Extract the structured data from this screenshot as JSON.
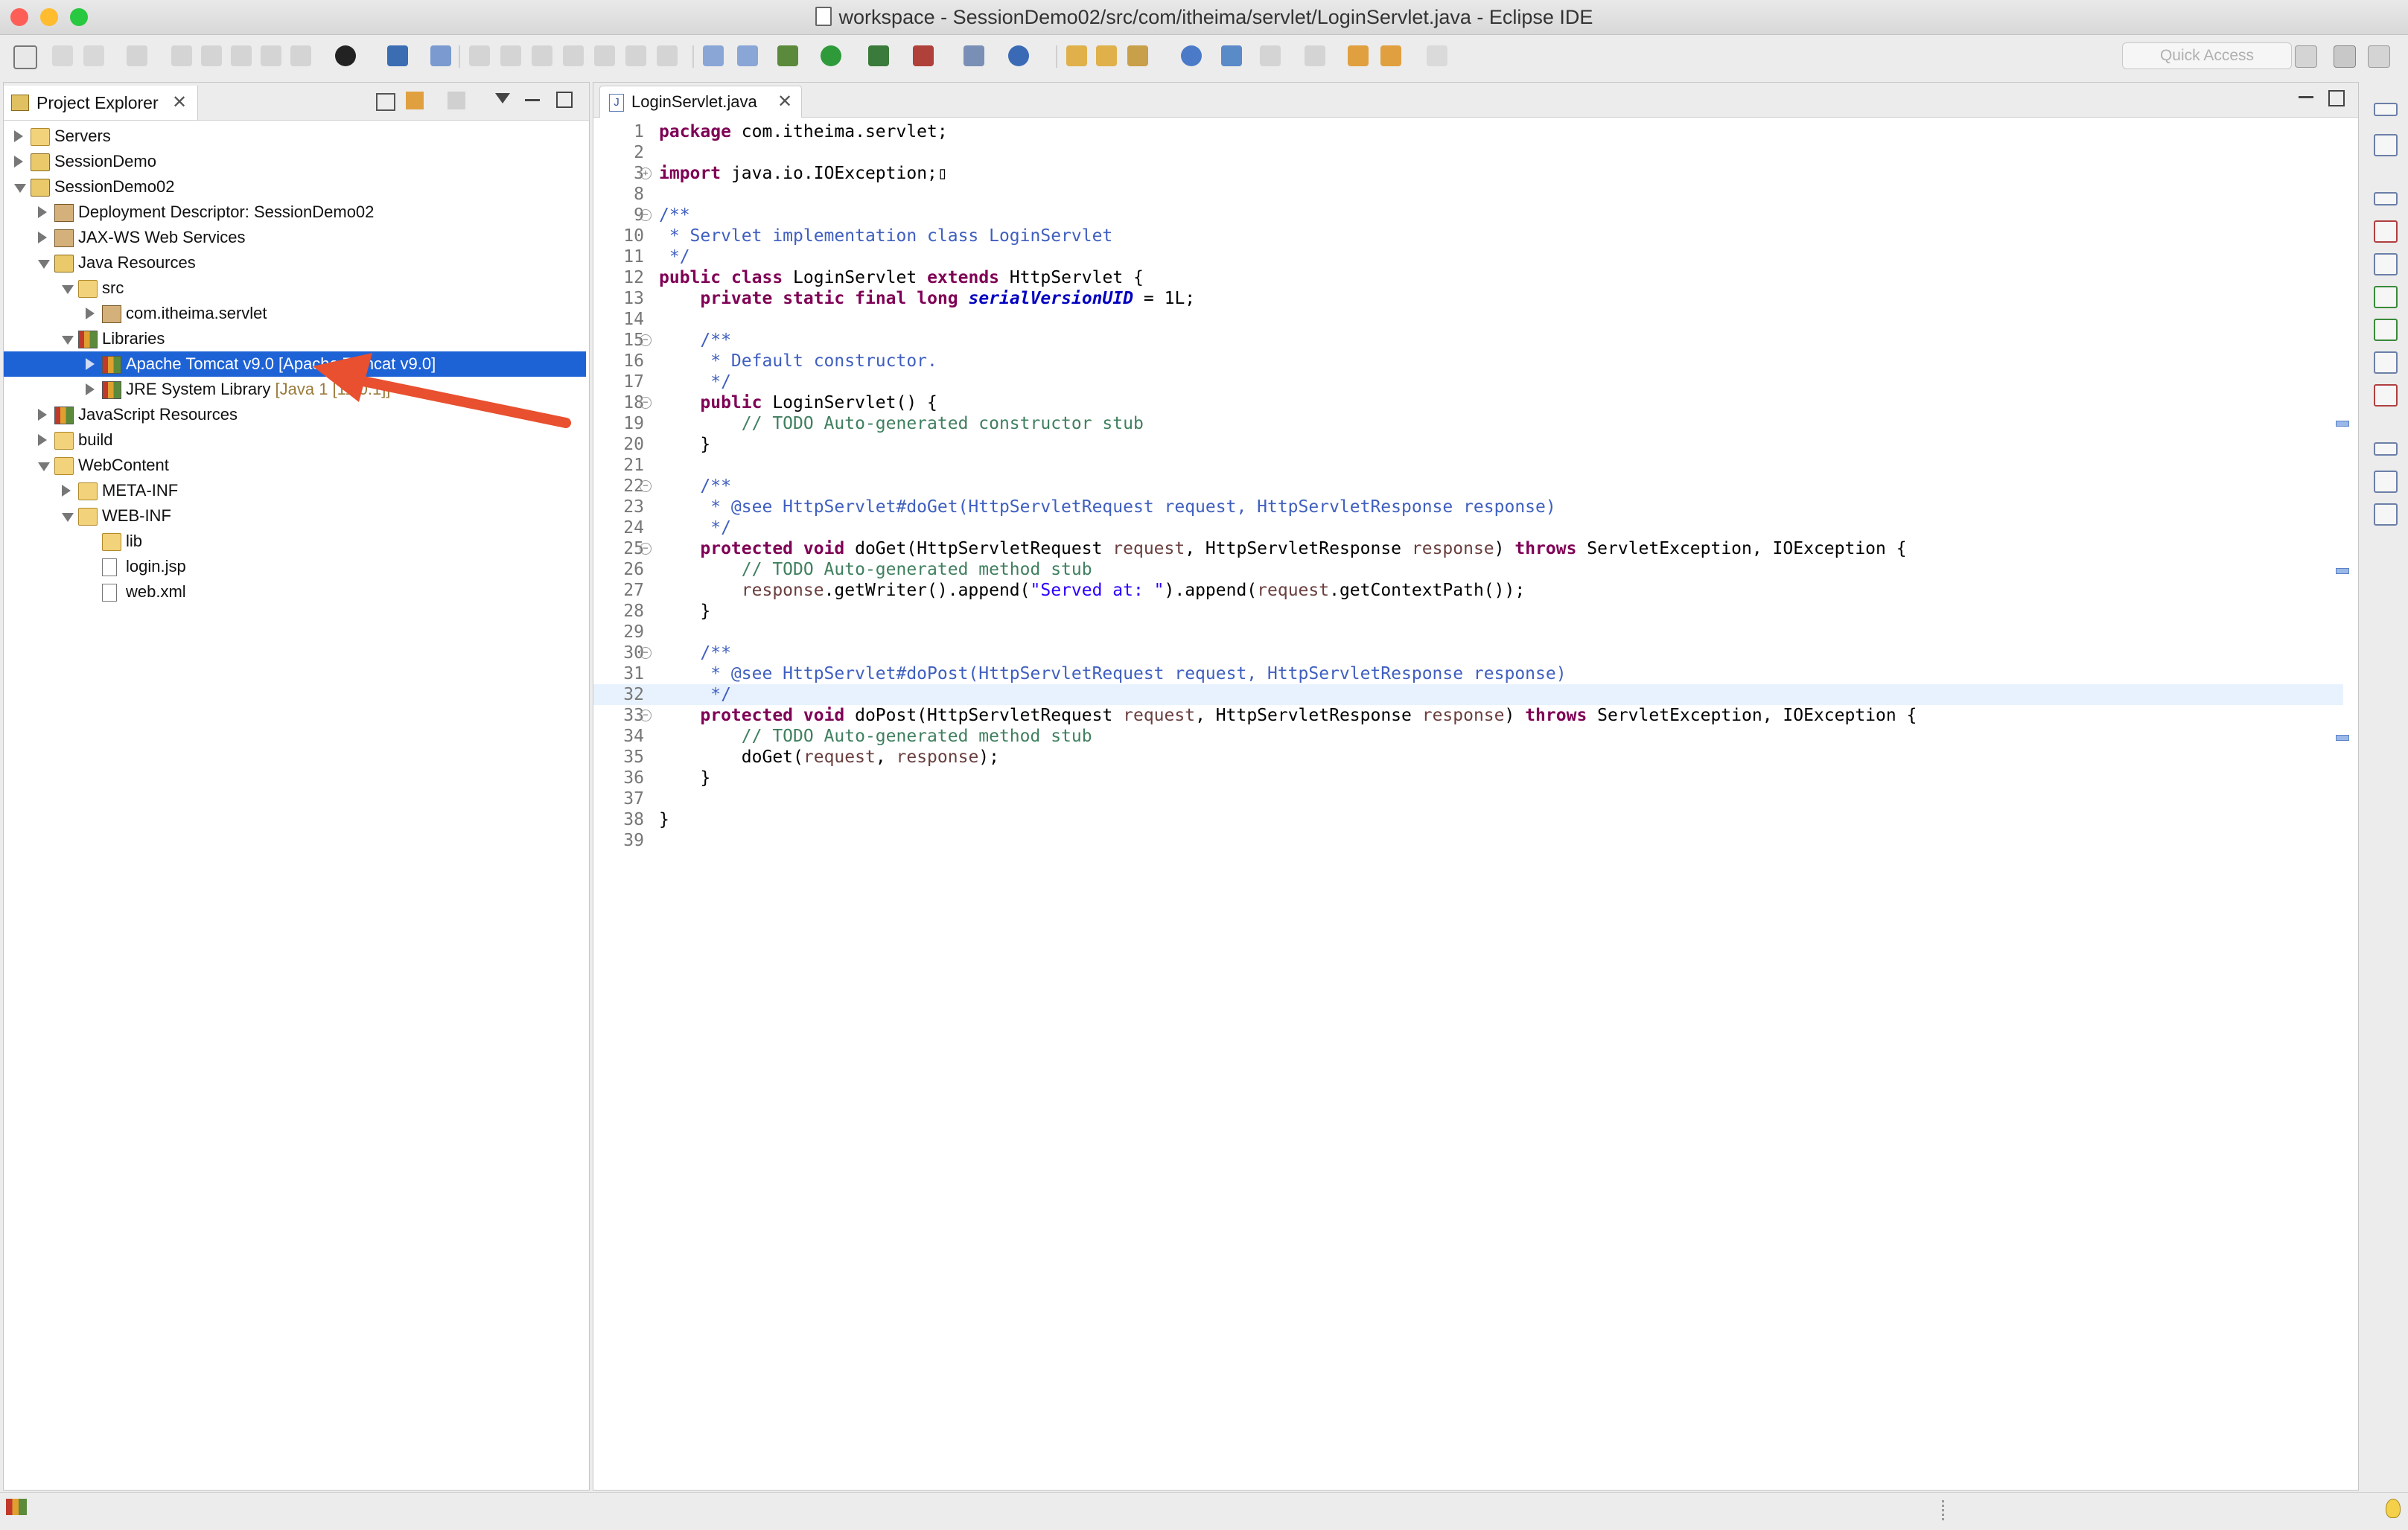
{
  "window": {
    "title": "workspace - SessionDemo02/src/com/itheima/servlet/LoginServlet.java - Eclipse IDE"
  },
  "toolbar": {
    "quick_access_placeholder": "Quick Access"
  },
  "explorer": {
    "tab_label": "Project Explorer",
    "tree": [
      {
        "label": "Servers",
        "depth": 0,
        "toggle": "closed",
        "icon": "folder-icon"
      },
      {
        "label": "SessionDemo",
        "depth": 0,
        "toggle": "closed",
        "icon": "project-icon"
      },
      {
        "label": "SessionDemo02",
        "depth": 0,
        "toggle": "open",
        "icon": "project-icon"
      },
      {
        "label": "Deployment Descriptor: SessionDemo02",
        "depth": 1,
        "toggle": "closed",
        "icon": "descriptor-icon"
      },
      {
        "label": "JAX-WS Web Services",
        "depth": 1,
        "toggle": "closed",
        "icon": "webservice-icon"
      },
      {
        "label": "Java Resources",
        "depth": 1,
        "toggle": "open",
        "icon": "java-resources-icon"
      },
      {
        "label": "src",
        "depth": 2,
        "toggle": "open",
        "icon": "source-folder-icon"
      },
      {
        "label": "com.itheima.servlet",
        "depth": 3,
        "toggle": "closed",
        "icon": "package-icon"
      },
      {
        "label": "Libraries",
        "depth": 2,
        "toggle": "open",
        "icon": "libraries-icon"
      },
      {
        "label": "Apache Tomcat v9.0 [Apache Tomcat v9.0]",
        "depth": 3,
        "toggle": "closed",
        "icon": "library-icon",
        "selected": true
      },
      {
        "label": "JRE System Library",
        "decoration": "[Java    1 [11.0.1]]",
        "depth": 3,
        "toggle": "closed",
        "icon": "library-icon"
      },
      {
        "label": "JavaScript Resources",
        "depth": 1,
        "toggle": "closed",
        "icon": "javascript-resources-icon"
      },
      {
        "label": "build",
        "depth": 1,
        "toggle": "closed",
        "icon": "folder-icon"
      },
      {
        "label": "WebContent",
        "depth": 1,
        "toggle": "open",
        "icon": "folder-icon"
      },
      {
        "label": "META-INF",
        "depth": 2,
        "toggle": "closed",
        "icon": "folder-icon"
      },
      {
        "label": "WEB-INF",
        "depth": 2,
        "toggle": "open",
        "icon": "folder-icon"
      },
      {
        "label": "lib",
        "depth": 3,
        "toggle": "none",
        "icon": "folder-icon"
      },
      {
        "label": "login.jsp",
        "depth": 3,
        "toggle": "none",
        "icon": "jsp-file-icon"
      },
      {
        "label": "web.xml",
        "depth": 3,
        "toggle": "none",
        "icon": "xml-file-icon"
      }
    ]
  },
  "editor": {
    "tab_label": "LoginServlet.java",
    "lines": [
      {
        "n": "1",
        "fold": "",
        "code": "<span class=\"kw\">package</span> com.itheima.servlet;"
      },
      {
        "n": "2",
        "fold": "",
        "code": ""
      },
      {
        "n": "3",
        "fold": "plus",
        "code": "<span class=\"kw\">import</span> java.io.IOException;▯"
      },
      {
        "n": "8",
        "fold": "",
        "code": ""
      },
      {
        "n": "9",
        "fold": "minus",
        "code": "<span class=\"jd\">/**</span>"
      },
      {
        "n": "10",
        "fold": "",
        "code": "<span class=\"jd\"> * Servlet implementation class LoginServlet</span>"
      },
      {
        "n": "11",
        "fold": "",
        "code": "<span class=\"jd\"> */</span>"
      },
      {
        "n": "12",
        "fold": "",
        "code": "<span class=\"kw\">public</span> <span class=\"kw\">class</span> LoginServlet <span class=\"kw\">extends</span> HttpServlet {"
      },
      {
        "n": "13",
        "fold": "",
        "code": "    <span class=\"kw\">private</span> <span class=\"kw\">static</span> <span class=\"kw\">final</span> <span class=\"kw\">long</span> <span class=\"fld\">serialVersionUID</span> = 1L;"
      },
      {
        "n": "14",
        "fold": "",
        "code": ""
      },
      {
        "n": "15",
        "fold": "minus",
        "code": "    <span class=\"jd\">/**</span>"
      },
      {
        "n": "16",
        "fold": "",
        "code": "<span class=\"jd\">     * Default constructor.</span>"
      },
      {
        "n": "17",
        "fold": "",
        "code": "<span class=\"jd\">     */</span>"
      },
      {
        "n": "18",
        "fold": "minus",
        "code": "    <span class=\"kw\">public</span> LoginServlet() {"
      },
      {
        "n": "19",
        "fold": "",
        "code": "        <span class=\"cm\">// TODO Auto-generated constructor stub</span>"
      },
      {
        "n": "20",
        "fold": "",
        "code": "    }"
      },
      {
        "n": "21",
        "fold": "",
        "code": ""
      },
      {
        "n": "22",
        "fold": "minus",
        "code": "    <span class=\"jd\">/**</span>"
      },
      {
        "n": "23",
        "fold": "",
        "code": "<span class=\"jd\">     * @see HttpServlet#doGet(HttpServletRequest request, HttpServletResponse response)</span>"
      },
      {
        "n": "24",
        "fold": "",
        "code": "<span class=\"jd\">     */</span>"
      },
      {
        "n": "25",
        "fold": "minus",
        "code": "    <span class=\"kw\">protected</span> <span class=\"kw\">void</span> doGet(HttpServletRequest <span class=\"prm\">request</span>, HttpServletResponse <span class=\"prm\">response</span>) <span class=\"kw\">throws</span> ServletException, IOException {"
      },
      {
        "n": "26",
        "fold": "",
        "code": "        <span class=\"cm\">// TODO Auto-generated method stub</span>"
      },
      {
        "n": "27",
        "fold": "",
        "code": "        <span class=\"prm\">response</span>.getWriter().append(<span class=\"str\">\"Served at: \"</span>).append(<span class=\"prm\">request</span>.getContextPath());"
      },
      {
        "n": "28",
        "fold": "",
        "code": "    }"
      },
      {
        "n": "29",
        "fold": "",
        "code": ""
      },
      {
        "n": "30",
        "fold": "minus",
        "code": "    <span class=\"jd\">/**</span>"
      },
      {
        "n": "31",
        "fold": "",
        "code": "<span class=\"jd\">     * @see HttpServlet#doPost(HttpServletRequest request, HttpServletResponse response)</span>"
      },
      {
        "n": "32",
        "fold": "",
        "code": "<span class=\"jd\">     */</span>",
        "highlight": true
      },
      {
        "n": "33",
        "fold": "minus",
        "code": "    <span class=\"kw\">protected</span> <span class=\"kw\">void</span> doPost(HttpServletRequest <span class=\"prm\">request</span>, HttpServletResponse <span class=\"prm\">response</span>) <span class=\"kw\">throws</span> ServletException, IOException {"
      },
      {
        "n": "34",
        "fold": "",
        "code": "        <span class=\"cm\">// TODO Auto-generated method stub</span>"
      },
      {
        "n": "35",
        "fold": "",
        "code": "        doGet(<span class=\"prm\">request</span>, <span class=\"prm\">response</span>);"
      },
      {
        "n": "36",
        "fold": "",
        "code": "    }"
      },
      {
        "n": "37",
        "fold": "",
        "code": ""
      },
      {
        "n": "38",
        "fold": "",
        "code": "}"
      },
      {
        "n": "39",
        "fold": "",
        "code": ""
      }
    ]
  },
  "colors": {
    "selection": "#1e63d6",
    "keyword": "#7f0055",
    "comment": "#3f7f5f",
    "javadoc": "#3f5fbf",
    "string": "#2a00ff",
    "annotation_arrow": "#e8502f"
  }
}
